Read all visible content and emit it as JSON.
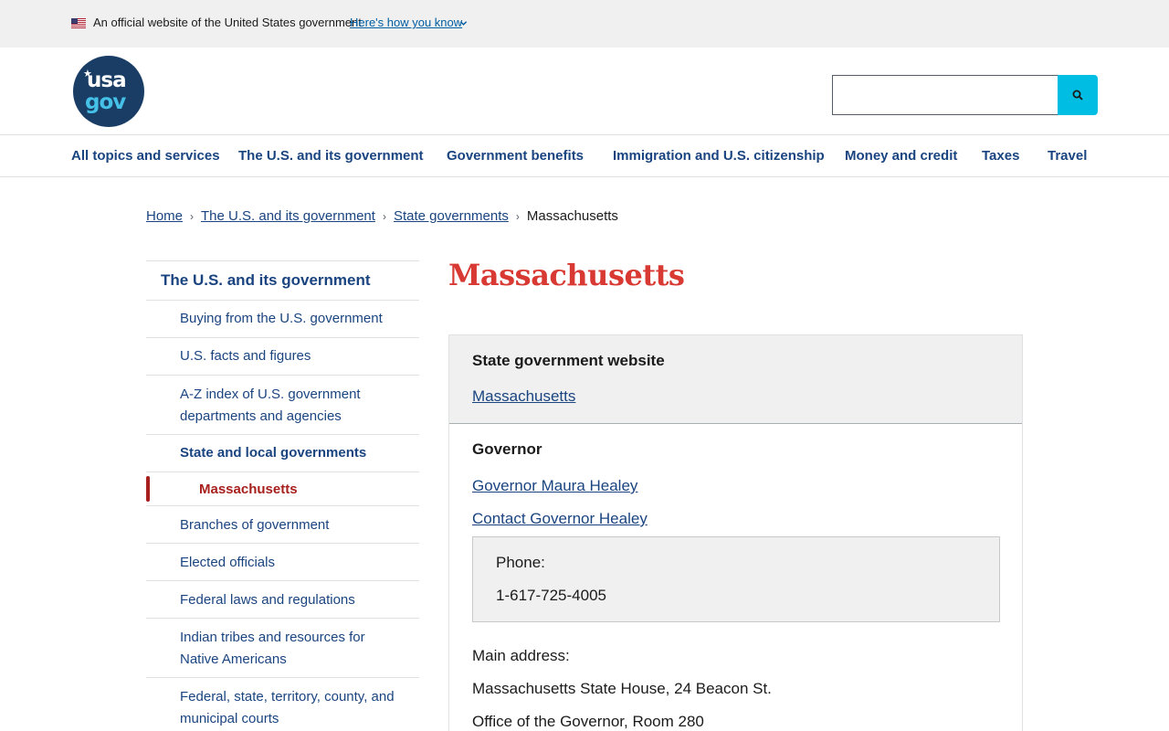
{
  "gov_banner": {
    "official_text": "An official website of the United States government",
    "how_you_know": "Here's how you know"
  },
  "header": {
    "logo_top": "usa",
    "logo_bottom": "gov",
    "search_placeholder": ""
  },
  "nav": {
    "items": [
      "All topics and services",
      "The U.S. and its government",
      "Government benefits",
      "Immigration and U.S. citizenship",
      "Money and credit",
      "Taxes",
      "Travel"
    ]
  },
  "breadcrumb": {
    "items": [
      "Home",
      "The U.S. and its government",
      "State governments"
    ],
    "current": "Massachusetts"
  },
  "sidenav": {
    "top": "The U.S. and its government",
    "items": [
      "Buying from the U.S. government",
      "U.S. facts and figures",
      "A-Z index of U.S. government departments and agencies",
      "State and local governments",
      "Massachusetts",
      "Branches of government",
      "Elected officials",
      "Federal laws and regulations",
      "Indian tribes and resources for Native Americans",
      "Federal, state, territory, county, and municipal courts"
    ]
  },
  "main": {
    "title": "Massachusetts",
    "website_label": "State government website",
    "website_link": "Massachusetts",
    "governor_label": "Governor",
    "governor_link": "Governor Maura Healey",
    "contact_link": "Contact Governor Healey",
    "phone_label": "Phone:",
    "phone_value": "1-617-725-4005",
    "address_label": "Main address:",
    "address_line1": "Massachusetts State House, 24 Beacon St.",
    "address_line2": "Office of the Governor, Room 280"
  },
  "colors": {
    "title_red": "#d83933",
    "link_blue": "#1a4480",
    "search_cyan": "#00bde3",
    "logo_navy": "#1a3d66"
  }
}
